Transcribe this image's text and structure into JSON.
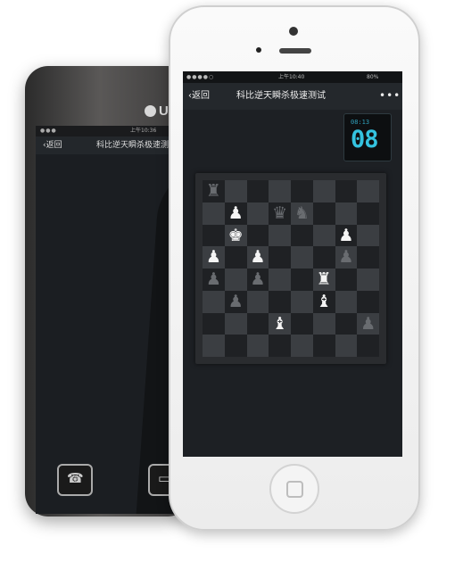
{
  "back_phone": {
    "brand_logo": "U",
    "status_time": "上午10:36",
    "back_label": "返回",
    "title": "科比逆天瞬杀极速测"
  },
  "front_phone": {
    "status": {
      "signal": "●●●●○",
      "time": "上午10:40",
      "battery": "80%"
    },
    "nav": {
      "back_label": "返回",
      "title": "科比逆天瞬杀极速测试",
      "more": "•••"
    },
    "timer": {
      "small": "08:13",
      "value": "08"
    },
    "board": {
      "pieces": [
        {
          "square": "a8",
          "glyph": "♜",
          "tone": "g",
          "name": "black-rook"
        },
        {
          "square": "b7",
          "glyph": "♟",
          "tone": "w",
          "name": "white-pawn"
        },
        {
          "square": "d7",
          "glyph": "♛",
          "tone": "g",
          "name": "black-queen"
        },
        {
          "square": "e7",
          "glyph": "♞",
          "tone": "g",
          "name": "black-knight"
        },
        {
          "square": "b6",
          "glyph": "♚",
          "tone": "w",
          "name": "white-king"
        },
        {
          "square": "g6",
          "glyph": "♟",
          "tone": "w",
          "name": "white-pawn"
        },
        {
          "square": "a5",
          "glyph": "♟",
          "tone": "w",
          "name": "white-pawn"
        },
        {
          "square": "c5",
          "glyph": "♟",
          "tone": "w",
          "name": "white-pawn"
        },
        {
          "square": "g5",
          "glyph": "♟",
          "tone": "g",
          "name": "black-pawn"
        },
        {
          "square": "a4",
          "glyph": "♟",
          "tone": "g",
          "name": "black-pawn"
        },
        {
          "square": "c4",
          "glyph": "♟",
          "tone": "g",
          "name": "black-pawn"
        },
        {
          "square": "f4",
          "glyph": "♜",
          "tone": "w",
          "name": "white-rook"
        },
        {
          "square": "b3",
          "glyph": "♟",
          "tone": "g",
          "name": "black-pawn"
        },
        {
          "square": "f3",
          "glyph": "♝",
          "tone": "w",
          "name": "white-bishop"
        },
        {
          "square": "d2",
          "glyph": "♝",
          "tone": "w",
          "name": "white-bishop"
        },
        {
          "square": "h2",
          "glyph": "♟",
          "tone": "g",
          "name": "black-pawn"
        }
      ]
    }
  }
}
